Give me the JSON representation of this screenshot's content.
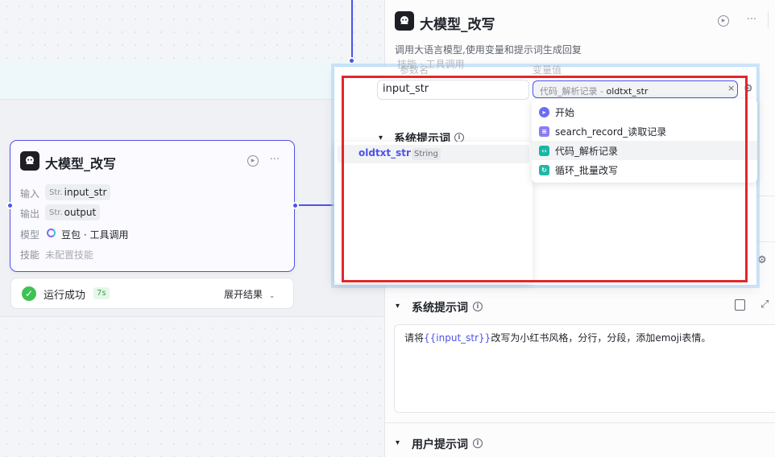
{
  "canvas": {
    "node": {
      "title": "大模型_改写",
      "rows": [
        {
          "label": "输入",
          "type": "Str.",
          "value": "input_str"
        },
        {
          "label": "输出",
          "type": "Str.",
          "value": "output"
        },
        {
          "label": "模型",
          "value": "豆包 · 工具调用"
        },
        {
          "label": "技能",
          "value": "未配置技能"
        }
      ]
    },
    "status": {
      "text": "运行成功",
      "time": "7s",
      "expand_label": "展开结果"
    }
  },
  "panel": {
    "title": "大模型_改写",
    "description": "调用大语言模型,使用变量和提示词生成回复",
    "behind_header_label": "技能 · 工具调用",
    "param_name_header": "参数名",
    "param_value_header": "变量值",
    "system_prompt": {
      "title": "系统提示词",
      "text_before": "请将",
      "variable": "{{input_str}}",
      "text_after": "改写为小红书风格，分行，分段，添加emoji表情。"
    },
    "user_prompt": {
      "title": "用户提示词"
    }
  },
  "popup": {
    "param_name_value": "input_str",
    "selected_variable": {
      "source": "代码_解析记录",
      "separator": " - ",
      "name": "oldtxt_str"
    },
    "inner_section_title": "系统提示词",
    "variable_list": [
      {
        "name": "oldtxt_str",
        "type": "String"
      }
    ],
    "node_list": [
      {
        "label": "开始",
        "icon_color": "#6b6cf6",
        "icon": "start-icon"
      },
      {
        "label": "search_record_读取记录",
        "icon_color": "#8a7cf5",
        "icon": "database-icon"
      },
      {
        "label": "代码_解析记录",
        "icon_color": "#16b7a5",
        "icon": "code-icon",
        "active": true
      },
      {
        "label": "循环_批量改写",
        "icon_color": "#1fb8a4",
        "icon": "loop-icon"
      }
    ]
  },
  "colors": {
    "accent": "#4d53e8",
    "success": "#3ec254",
    "highlight_box": "#e3262c"
  }
}
